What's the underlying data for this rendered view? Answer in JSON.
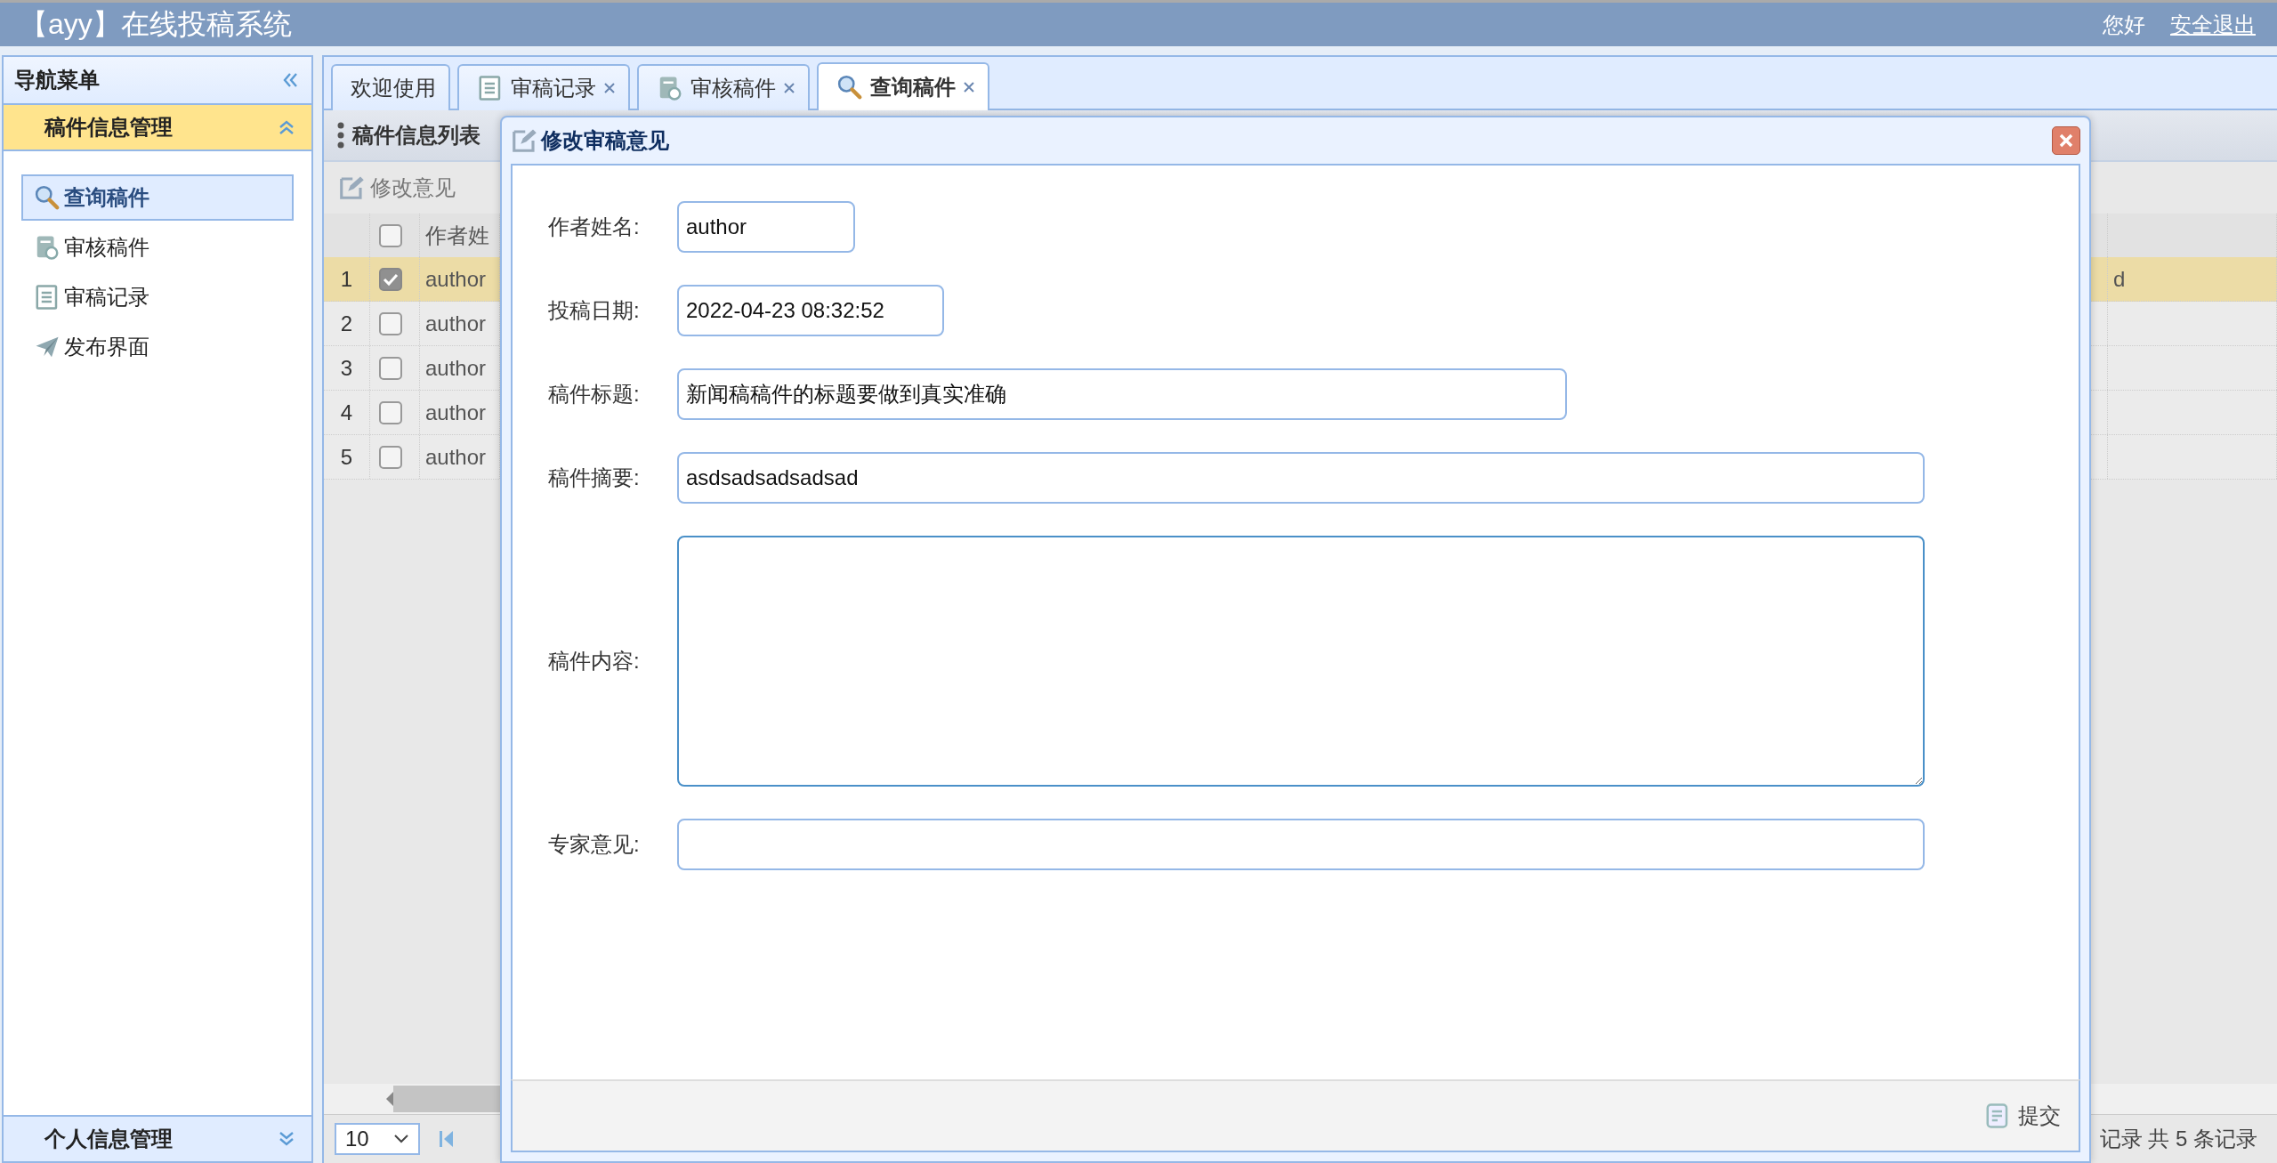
{
  "header": {
    "title": "【ayy】在线投稿系统",
    "greeting": "您好",
    "logout": "安全退出"
  },
  "sidebar": {
    "title": "导航菜单",
    "groups": [
      {
        "label": "稿件信息管理",
        "expanded": true,
        "items": [
          {
            "label": "查询稿件",
            "kind": "search",
            "selected": true
          },
          {
            "label": "审核稿件",
            "kind": "review",
            "selected": false
          },
          {
            "label": "审稿记录",
            "kind": "record",
            "selected": false
          },
          {
            "label": "发布界面",
            "kind": "send",
            "selected": false
          }
        ]
      },
      {
        "label": "个人信息管理",
        "expanded": false
      }
    ]
  },
  "tabs": [
    {
      "label": "欢迎使用",
      "kind": "plain",
      "closable": false,
      "selected": false
    },
    {
      "label": "审稿记录",
      "kind": "record",
      "closable": true,
      "selected": false
    },
    {
      "label": "审核稿件",
      "kind": "review",
      "closable": true,
      "selected": false
    },
    {
      "label": "查询稿件",
      "kind": "search",
      "closable": true,
      "selected": true
    }
  ],
  "panel": {
    "title": "稿件信息列表",
    "toolbar": [
      "修改意见"
    ],
    "select_all_checked": false,
    "columns": [
      "作者姓"
    ],
    "rows": [
      {
        "index": "1",
        "checked": true,
        "selected": true,
        "column_1": "author",
        "column_3": "d"
      },
      {
        "index": "2",
        "checked": false,
        "selected": false,
        "column_1": "author"
      },
      {
        "index": "3",
        "checked": false,
        "selected": false,
        "column_1": "author"
      },
      {
        "index": "4",
        "checked": false,
        "selected": false,
        "column_1": "author"
      },
      {
        "index": "5",
        "checked": false,
        "selected": false,
        "column_1": "author"
      }
    ],
    "pager": {
      "page_size": "10",
      "summary": "记录 共 5 条记录"
    }
  },
  "dialog": {
    "title": "修改审稿意见",
    "fields": [
      {
        "label": "作者姓名:",
        "kind": "input",
        "value": "author"
      },
      {
        "label": "投稿日期:",
        "kind": "input",
        "value": "2022-04-23 08:32:52"
      },
      {
        "label": "稿件标题:",
        "kind": "input",
        "value": "新闻稿稿件的标题要做到真实准确"
      },
      {
        "label": "稿件摘要:",
        "kind": "input",
        "value": "asdsadsadsadsad"
      },
      {
        "label": "稿件内容:",
        "kind": "textarea"
      },
      {
        "label": "专家意见:",
        "kind": "input"
      }
    ],
    "submit": "提交"
  }
}
